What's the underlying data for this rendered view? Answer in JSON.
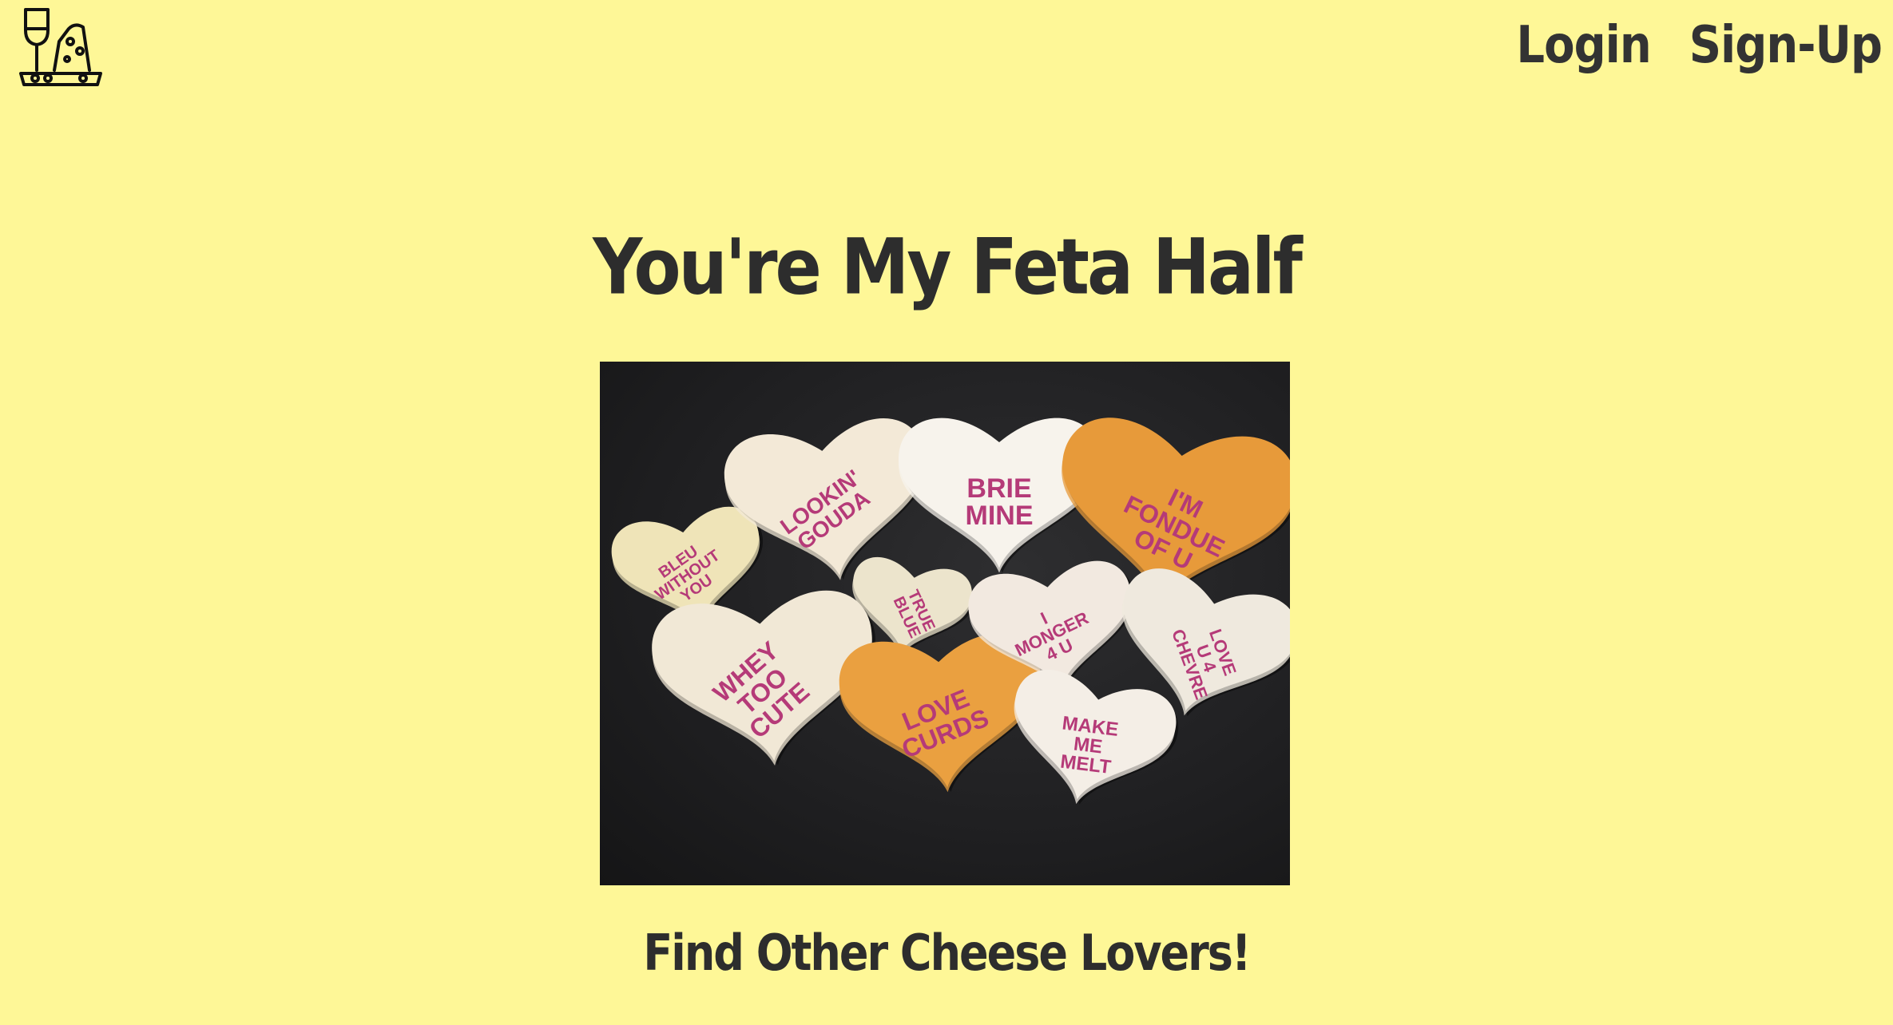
{
  "header": {
    "logo_icon": "wine-and-cheese-icon",
    "nav": {
      "login_label": "Login",
      "signup_label": "Sign-Up"
    }
  },
  "main": {
    "title": "You're My Feta Half",
    "image": {
      "hearts": [
        {
          "lines": [
            "BLEU",
            "WITHOUT",
            "YOU"
          ]
        },
        {
          "lines": [
            "LOOKIN'",
            "GOUDA"
          ]
        },
        {
          "lines": [
            "TRUE",
            "BLUE"
          ]
        },
        {
          "lines": [
            "BRIE",
            "MINE"
          ]
        },
        {
          "lines": [
            "I'M",
            "FONDUE",
            "OF U"
          ]
        },
        {
          "lines": [
            "WHEY",
            "TOO",
            "CUTE"
          ]
        },
        {
          "lines": [
            "LOVE",
            "CURDS"
          ]
        },
        {
          "lines": [
            "I",
            "MONGER",
            "4 U"
          ]
        },
        {
          "lines": [
            "LOVE",
            "U 4",
            "CHEVRE"
          ]
        },
        {
          "lines": [
            "MAKE",
            "ME",
            "MELT"
          ]
        }
      ]
    },
    "cta": "Find Other Cheese Lovers!"
  },
  "colors": {
    "background": "#FEF797",
    "text": "#2d2d2d",
    "heart_text": "#b53a78"
  }
}
